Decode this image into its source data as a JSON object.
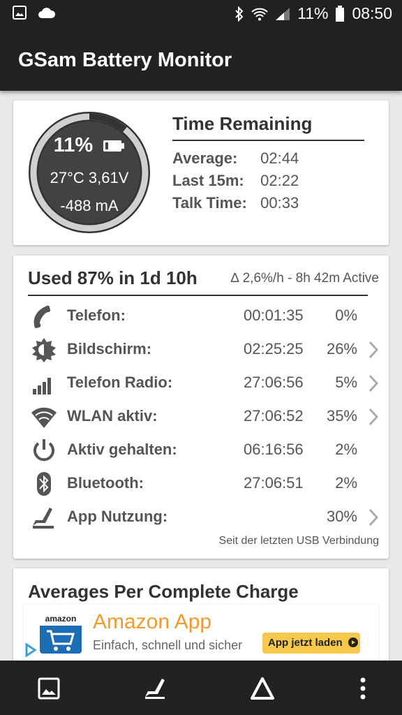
{
  "status_bar": {
    "left_icons": [
      "image-icon",
      "cloud-icon"
    ],
    "right_icons": [
      "bluetooth-icon",
      "wifi-icon",
      "signal-icon",
      "battery-icon"
    ],
    "battery_text": "11%",
    "time": "08:50"
  },
  "app_bar": {
    "title": "GSam Battery Monitor"
  },
  "gauge": {
    "percent_text": "11%",
    "level": 0.11,
    "temp_voltage": "27°C  3,61V",
    "current": "-488 mA"
  },
  "time_remaining": {
    "title": "Time Remaining",
    "rows": [
      {
        "label": "Average:",
        "value": "02:44"
      },
      {
        "label": "Last 15m:",
        "value": "02:22"
      },
      {
        "label": "Talk Time:",
        "value": "00:33"
      }
    ]
  },
  "usage": {
    "title": "Used 87% in 1d 10h",
    "subtitle": "∆ 2,6%/h - 8h 42m Active",
    "rows": [
      {
        "icon": "phone-icon",
        "label": "Telefon:",
        "time": "00:01:35",
        "percent": "0%"
      },
      {
        "icon": "brightness-icon",
        "label": "Bildschirm:",
        "time": "02:25:25",
        "percent": "26%"
      },
      {
        "icon": "signal-bars-icon",
        "label": "Telefon Radio:",
        "time": "27:06:56",
        "percent": "5%"
      },
      {
        "icon": "wifi-icon",
        "label": "WLAN aktiv:",
        "time": "27:06:52",
        "percent": "35%"
      },
      {
        "icon": "power-icon",
        "label": "Aktiv gehalten:",
        "time": "06:16:56",
        "percent": "2%"
      },
      {
        "icon": "bluetooth-icon",
        "label": "Bluetooth:",
        "time": "27:06:51",
        "percent": "2%"
      },
      {
        "icon": "app-usage-icon",
        "label": "App Nutzung:",
        "time": "",
        "percent": "30%"
      }
    ],
    "note": "Seit der letzten USB Verbindung"
  },
  "averages": {
    "title": "Averages Per Complete Charge"
  },
  "ad": {
    "logo_text": "amazon",
    "title": "Amazon App",
    "subtitle": "Einfach, schnell und sicher",
    "button": "App jetzt laden"
  },
  "bottom_nav": [
    "image-icon",
    "app-usage-icon",
    "delta-icon",
    "more-vert-icon"
  ],
  "colors": {
    "header": "#222222",
    "card_bg": "#ffffff",
    "page_bg": "#e9e9e9",
    "gauge_fill": "#424242",
    "gauge_ring": "#d0d0d0",
    "ad_orange": "#f59a2a",
    "ad_button": "#f6c84b"
  }
}
